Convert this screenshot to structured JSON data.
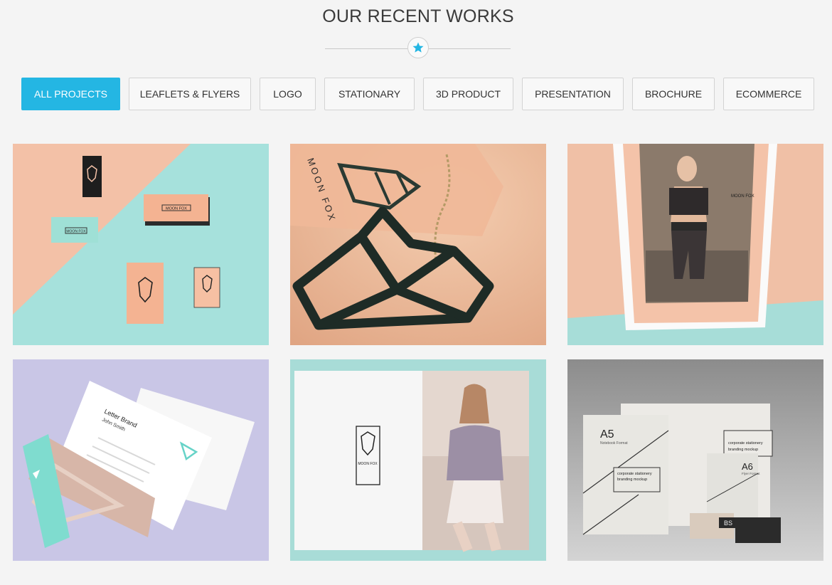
{
  "section": {
    "title": "OUR RECENT WORKS"
  },
  "accent_color": "#24b6e3",
  "filters": [
    {
      "label": "ALL PROJECTS",
      "active": true
    },
    {
      "label": "LEAFLETS & FLYERS",
      "active": false
    },
    {
      "label": "LOGO",
      "active": false
    },
    {
      "label": "STATIONARY",
      "active": false
    },
    {
      "label": "3D PRODUCT",
      "active": false
    },
    {
      "label": "PRESENTATION",
      "active": false
    },
    {
      "label": "BROCHURE",
      "active": false
    },
    {
      "label": "ECOMMERCE",
      "active": false
    }
  ],
  "portfolio": {
    "moon_fox_text": "MOON FOX",
    "letter_brand": "Letter Brand",
    "letter_name": "John Smith",
    "a5_label": "A5",
    "a5_sub": "Notebook Format",
    "a6_label": "A6",
    "a6_sub": "Flyer Format",
    "b5_label": "BS",
    "mockup_title_1": "corporate stationery",
    "mockup_title_2": "branding mockup"
  }
}
